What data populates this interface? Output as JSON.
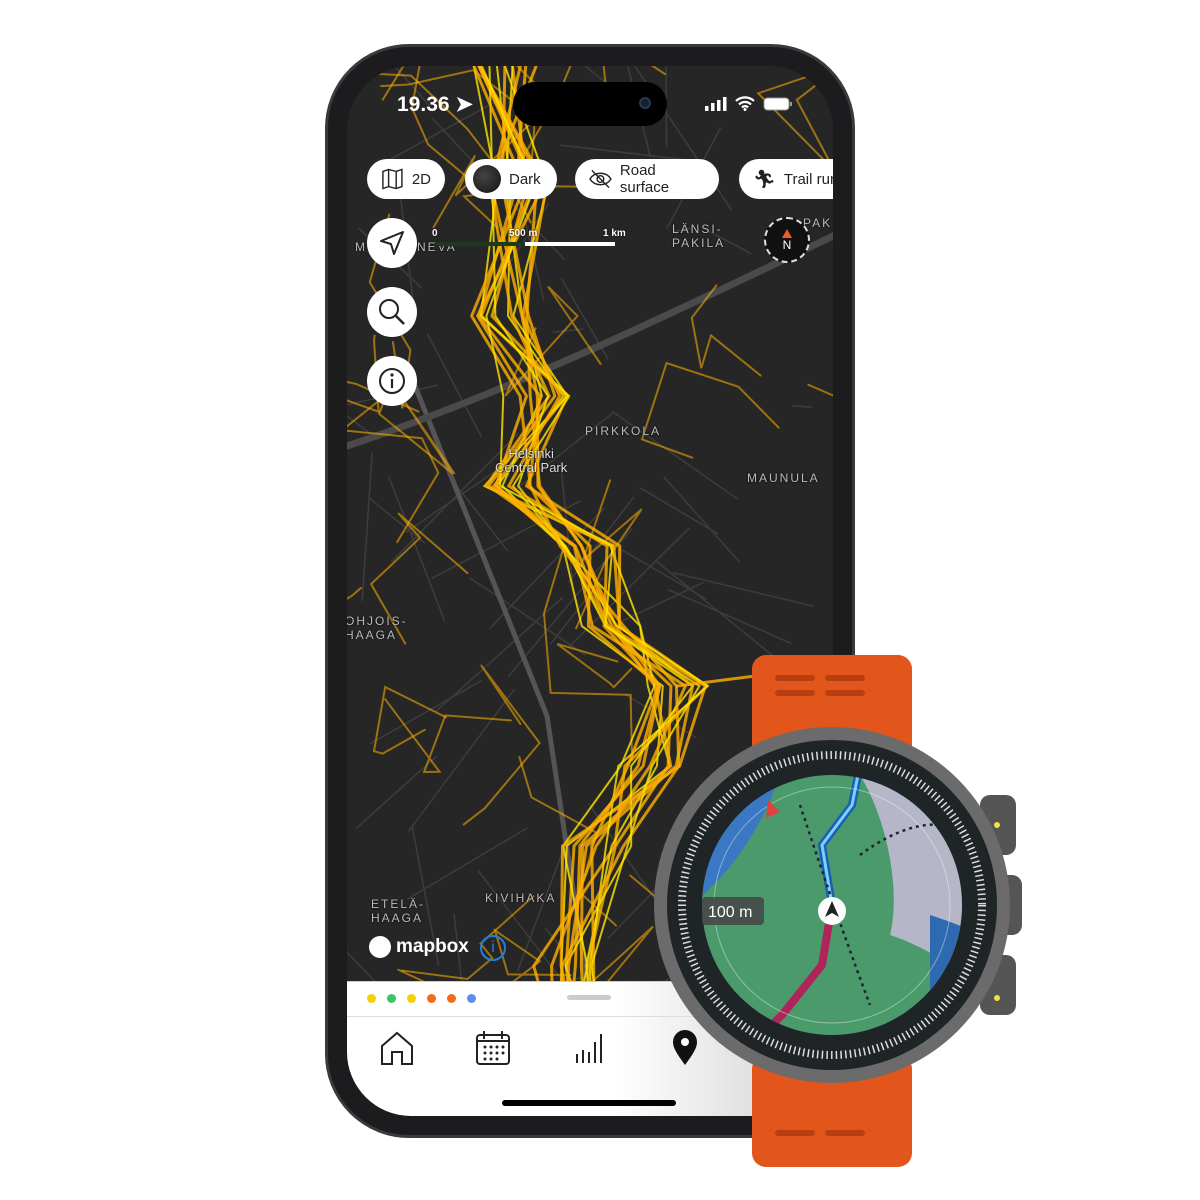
{
  "status_bar": {
    "time": "19.36",
    "icons": [
      "location-arrow-icon",
      "signal-icon",
      "wifi-icon",
      "battery-icon"
    ]
  },
  "map_controls": {
    "chips": [
      {
        "icon": "map-2d-icon",
        "label": "2D"
      },
      {
        "icon": "dark-style-thumbnail",
        "label": "Dark"
      },
      {
        "icon": "eye-slash-icon",
        "label": "Road surface"
      },
      {
        "icon": "trail-run-icon",
        "label": "Trail run"
      }
    ],
    "buttons": [
      "locate-icon",
      "search-icon",
      "info-icon"
    ],
    "compass_label": "N"
  },
  "scale_bar": {
    "ticks": [
      "0",
      "500 m",
      "1 km"
    ]
  },
  "map_labels": {
    "m": "M",
    "neva": "NEVA",
    "lansi_pakila": "LÄNSI-\nPAKILA",
    "pak": "PAK",
    "pirkkola": "PIRKKOLA",
    "central_park": "Helsinki\nCentral Park",
    "maunula": "MAUNULA",
    "pohjois_haaga": "OHJOIS-\nHAAGA",
    "etela_haaga": "ETELÄ-\nHAAGA",
    "kivihaka": "KIVIHAKA"
  },
  "attribution": {
    "logo": "mapbox"
  },
  "legend_dots": [
    "#f5d000",
    "#3cc26a",
    "#f5d000",
    "#f26b1d",
    "#f26b1d",
    "#5b8def"
  ],
  "tabbar": [
    "home-icon",
    "calendar-icon",
    "bar-chart-icon",
    "map-pin-icon"
  ],
  "watch": {
    "scale_label": "100 m",
    "strap_color": "#e2561b"
  },
  "colors": {
    "heatmap": "#ffb000",
    "heatmap_hot": "#ffe600",
    "map_bg": "#262626"
  }
}
